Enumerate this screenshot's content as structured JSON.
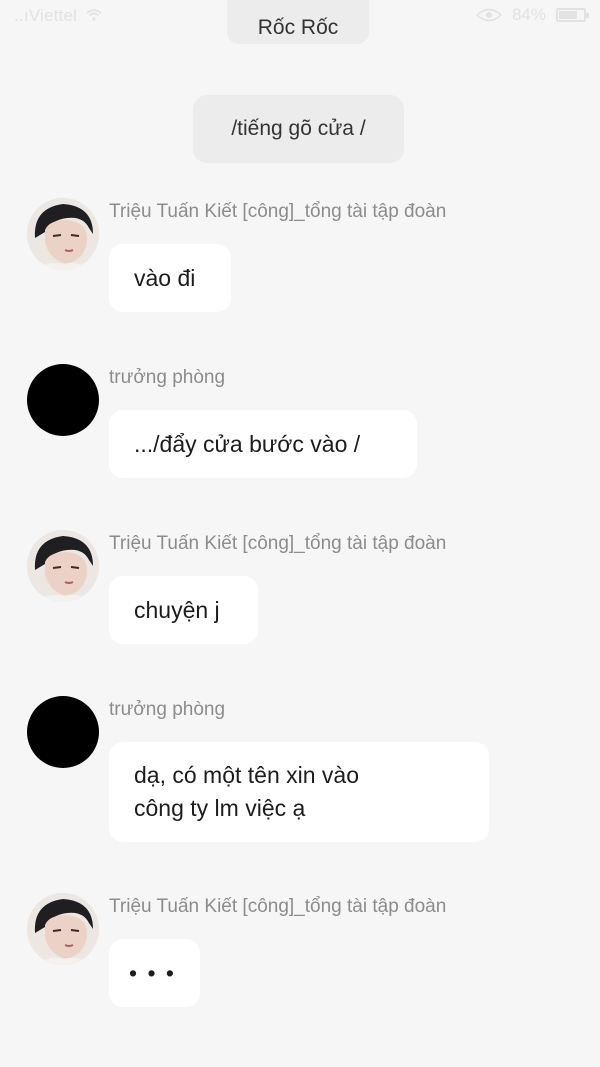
{
  "status_bar": {
    "carrier": "..ıViettel",
    "battery": "84%",
    "battery_level": 0.84
  },
  "header": {
    "title": "Rốc Rốc"
  },
  "note": {
    "text": "/tiếng gõ cửa /"
  },
  "messages": [
    {
      "sender": "Triệu Tuấn Kiết [công]_tổng tài tập đoàn",
      "text": "vào đi",
      "avatar": "character-portrait"
    },
    {
      "sender": "trưởng phòng",
      "text": ".../đẩy cửa bước vào /",
      "avatar": "black-circle"
    },
    {
      "sender": "Triệu Tuấn Kiết [công]_tổng tài tập đoàn",
      "text": "chuyện j",
      "avatar": "character-portrait"
    },
    {
      "sender": "trưởng phòng",
      "text": "dạ, có một tên xin  vào\ncông ty lm việc ạ",
      "avatar": "black-circle"
    },
    {
      "sender": "Triệu Tuấn Kiết [công]_tổng tài tập đoàn",
      "text": "• • •",
      "avatar": "character-portrait"
    }
  ]
}
